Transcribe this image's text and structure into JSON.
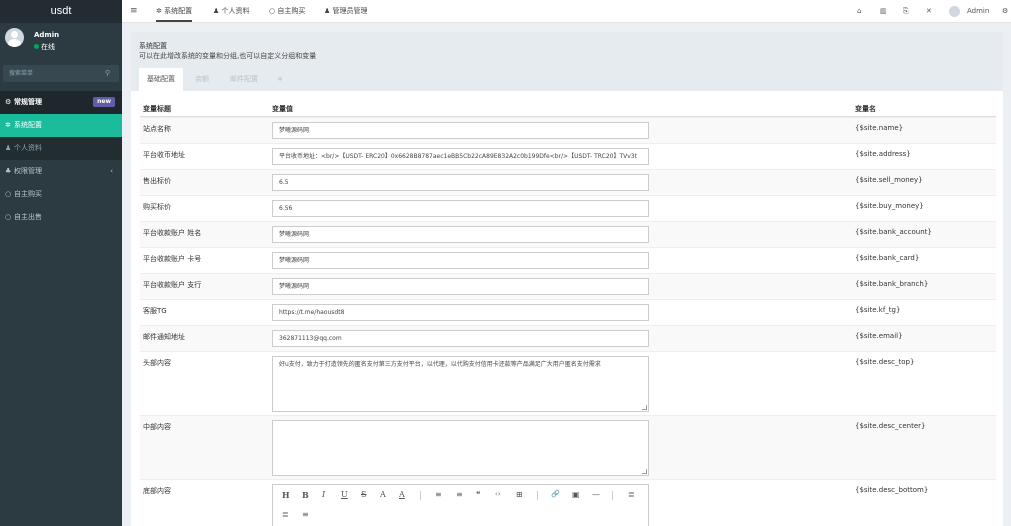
{
  "brand": "usdt",
  "user": {
    "name": "Admin",
    "status": "在线"
  },
  "search": {
    "placeholder": "搜索菜单"
  },
  "nav": [
    {
      "label": "常规管理",
      "badge": "new",
      "icon": "gears-icon"
    },
    {
      "label": "系统配置",
      "icon": "gear-icon"
    },
    {
      "label": "个人资料",
      "icon": "user-icon"
    },
    {
      "label": "权限管理",
      "icon": "group-icon",
      "caret": "‹"
    },
    {
      "label": "自主购买",
      "icon": "circle-icon"
    },
    {
      "label": "自主出售",
      "icon": "circle-icon"
    }
  ],
  "topbar": {
    "menu_icon": "menu-icon",
    "tabs": [
      {
        "label": "系统配置",
        "icon": "gear-icon"
      },
      {
        "label": "个人资料",
        "icon": "user-icon"
      },
      {
        "label": "自主购买",
        "icon": "circle-icon"
      },
      {
        "label": "管理员管理",
        "icon": "user-icon"
      }
    ],
    "icons": [
      "home-icon",
      "trash-icon",
      "translate-icon",
      "fullscreen-icon"
    ],
    "user": "Admin",
    "settings_icon": "gears-icon"
  },
  "panel": {
    "title": "系统配置",
    "subtitle": "可以在此增改系统的变量和分组,也可以自定义分组和变量",
    "tabs": [
      "基础配置",
      "余额",
      "邮件配置",
      "+"
    ]
  },
  "table": {
    "headers": [
      "变量标题",
      "变量值",
      "变量名"
    ],
    "rows": [
      {
        "label": "站点名称",
        "value": "梦曦源码网",
        "var": "{$site.name}"
      },
      {
        "label": "平台收币地址",
        "value": "平台收币地址：<br/>【USDT- ERC20】0x6628B8787aec1eBB5Cb22cA89E832A2c0b199Dfe<br/>【USDT- TRC20】TVv3t",
        "var": "{$site.address}"
      },
      {
        "label": "售出标价",
        "value": "6.5",
        "var": "{$site.sell_money}"
      },
      {
        "label": "购买标价",
        "value": "6.56",
        "var": "{$site.buy_money}"
      },
      {
        "label": "平台收款账户 姓名",
        "value": "梦曦源码网",
        "var": "{$site.bank_account}"
      },
      {
        "label": "平台收款账户 卡号",
        "value": "梦曦源码网",
        "var": "{$site.bank_card}"
      },
      {
        "label": "平台收款账户 支行",
        "value": "梦曦源码网",
        "var": "{$site.bank_branch}"
      },
      {
        "label": "客服TG",
        "value": "https://t.me/haousdt8",
        "var": "{$site.kf_tg}"
      },
      {
        "label": "邮件通知地址",
        "value": "362871113@qq.com",
        "var": "{$site.email}"
      },
      {
        "label": "头部内容",
        "value": "好u支付，致力于打造领先的匿名支付第三方支付平台，以代理，以代购支付信用卡还款等产品满足广大用户匿名支付需求",
        "var": "{$site.desc_top}"
      },
      {
        "label": "中部内容",
        "value": "",
        "var": "{$site.desc_center}"
      },
      {
        "label": "底部内容",
        "value": "",
        "var": "{$site.desc_bottom}"
      }
    ]
  },
  "editor_toolbar": [
    "H",
    "B",
    "I",
    "U",
    "S",
    "A",
    "A",
    "≡",
    "≡",
    "❝",
    "‹›",
    "⊞",
    "🔗",
    "▣",
    "—",
    "≣",
    "≣",
    "≡"
  ]
}
